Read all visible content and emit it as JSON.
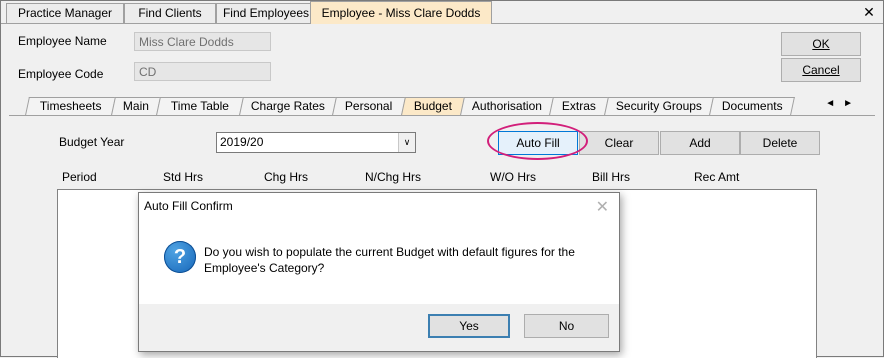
{
  "top_tabs": [
    "Practice Manager",
    "Find Clients",
    "Find Employees",
    "Employee - Miss Clare Dodds"
  ],
  "close_glyph": "✕",
  "employee": {
    "name_label": "Employee Name",
    "name_value": "Miss Clare Dodds",
    "code_label": "Employee Code",
    "code_value": "CD"
  },
  "buttons": {
    "ok": "OK",
    "cancel": "Cancel"
  },
  "sub_tabs": [
    "Timesheets",
    "Main",
    "Time Table",
    "Charge Rates",
    "Personal",
    "Budget",
    "Authorisation",
    "Extras",
    "Security Groups",
    "Documents"
  ],
  "active_sub_tab": "Budget",
  "budget": {
    "year_label": "Budget Year",
    "year_value": "2019/20",
    "actions": {
      "auto_fill": "Auto Fill",
      "clear": "Clear",
      "add": "Add",
      "delete": "Delete"
    },
    "columns": [
      "Period",
      "Std Hrs",
      "Chg Hrs",
      "N/Chg Hrs",
      "W/O Hrs",
      "Bill Hrs",
      "Rec Amt"
    ]
  },
  "dialog": {
    "title": "Auto Fill Confirm",
    "message": "Do you wish to populate the current Budget with default figures for the Employee's Category?",
    "yes": "Yes",
    "no": "No",
    "icon": "question-icon"
  },
  "colors": {
    "active_tab": "#fce9c8",
    "highlight": "#d21f7a",
    "dialog_default_border": "#3c7fb1"
  }
}
